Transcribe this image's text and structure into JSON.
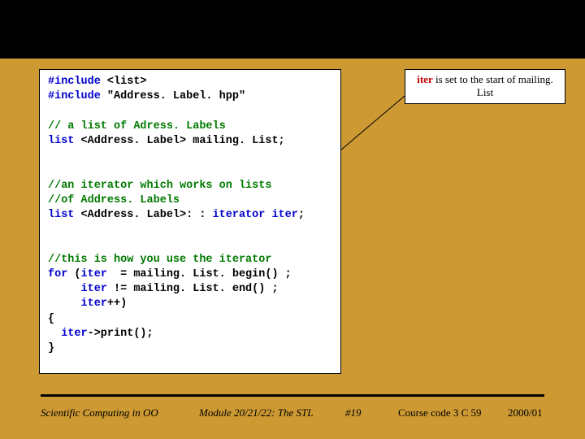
{
  "code": {
    "l1a": "#include",
    "l1b": " <list>",
    "l2a": "#include",
    "l2b": " \"Address. Label. hpp\"",
    "l3": "// a list of Adress. Labels",
    "l4a": "list ",
    "l4b": "<Address. Label> mailing. List;",
    "l5": "//an iterator which works on lists",
    "l6": "//of Address. Labels",
    "l7a": "list ",
    "l7b": "<Address. Label>: : ",
    "l7c": "iterator",
    "l7d": " iter",
    "l7e": ";",
    "l8": "//this is how you use the iterator",
    "l9a": "for ",
    "l9b": "(",
    "l9c": "iter",
    "l9d": "  = mailing. List. begin() ;",
    "l10a": "     ",
    "l10b": "iter",
    "l10c": " != mailing. List. end() ;",
    "l11a": "     ",
    "l11b": "iter",
    "l11c": "++)",
    "l12": "{",
    "l13a": "  ",
    "l13b": "iter",
    "l13c": "->print();",
    "l14": "}"
  },
  "callout": {
    "iter": "iter",
    "rest": " is set to the start of mailing. List"
  },
  "footer": {
    "left": "Scientific Computing in OO",
    "module": "Module 20/21/22: The STL",
    "page": "#19",
    "course": "Course code 3 C 59",
    "year": "2000/01"
  }
}
